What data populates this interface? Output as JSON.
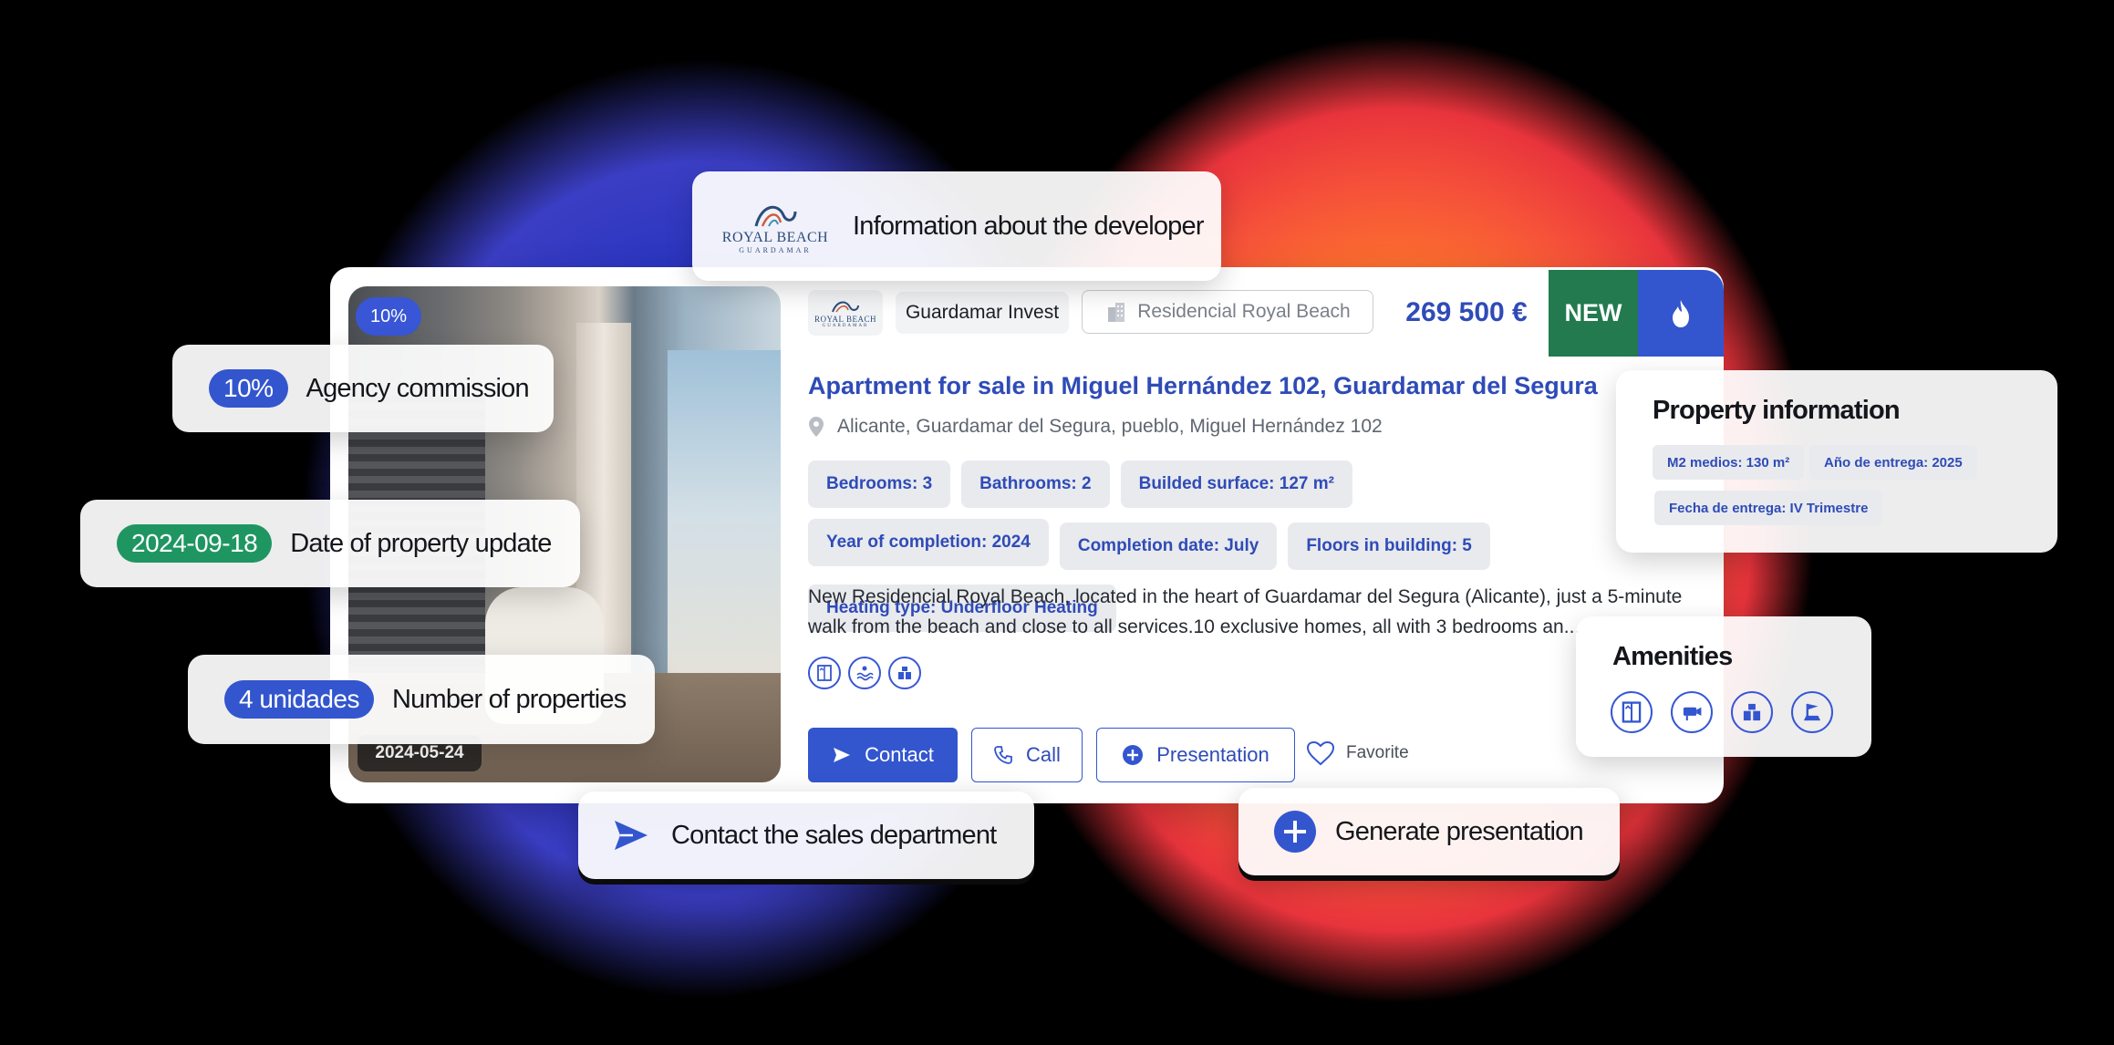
{
  "developer": {
    "logo_text": "ROYAL BEACH",
    "logo_sub": "GUARDAMAR",
    "callout": "Information about the developer",
    "name": "Guardamar Invest"
  },
  "project": {
    "name": "Residencial Royal Beach"
  },
  "listing": {
    "price": "269 500 €",
    "tag_new": "NEW",
    "commission_badge": "10%",
    "photo_date": "2024-05-24",
    "title": "Apartment for sale in Miguel Hernández 102, Guardamar del Segura",
    "address": "Alicante, Guardamar del Segura, pueblo, Miguel Hernández 102",
    "features": [
      "Bedrooms: 3",
      "Bathrooms: 2",
      "Builded surface: 127 m²",
      "Year of completion: 2024",
      "Completion date: July",
      "Floors in building: 5",
      "Heating type: Underfloor Heating"
    ],
    "description": "New Residencial Royal Beach, located in the heart of Guardamar del Segura (Alicante), just a 5-minute walk from the beach and close to all services.10 exclusive homes, all with 3 bedrooms an...",
    "amenity_icons": [
      "elevator-icon",
      "pool-icon",
      "storage-icon"
    ]
  },
  "actions": {
    "contact": "Contact",
    "call": "Call",
    "presentation": "Presentation",
    "favorite": "Favorite"
  },
  "callouts": {
    "commission_value": "10%",
    "commission_label": "Agency commission",
    "update_value": "2024-09-18",
    "update_label": "Date of property update",
    "units_value": "4 unidades",
    "units_label": "Number of properties",
    "contact_label": "Contact the sales department",
    "generate_label": "Generate presentation"
  },
  "property_info": {
    "title": "Property information",
    "items": [
      "M2 medios: 130 m²",
      "Año de entrega: 2025",
      "Fecha de entrega: IV Trimestre"
    ]
  },
  "amenities": {
    "title": "Amenities",
    "icons": [
      "elevator-icon",
      "cctv-icon",
      "storage-icon",
      "concierge-icon"
    ]
  },
  "colors": {
    "accent": "#3356cf",
    "title_blue": "#2f4bb7",
    "green": "#227a4e",
    "chip_bg": "#e8eaee"
  }
}
